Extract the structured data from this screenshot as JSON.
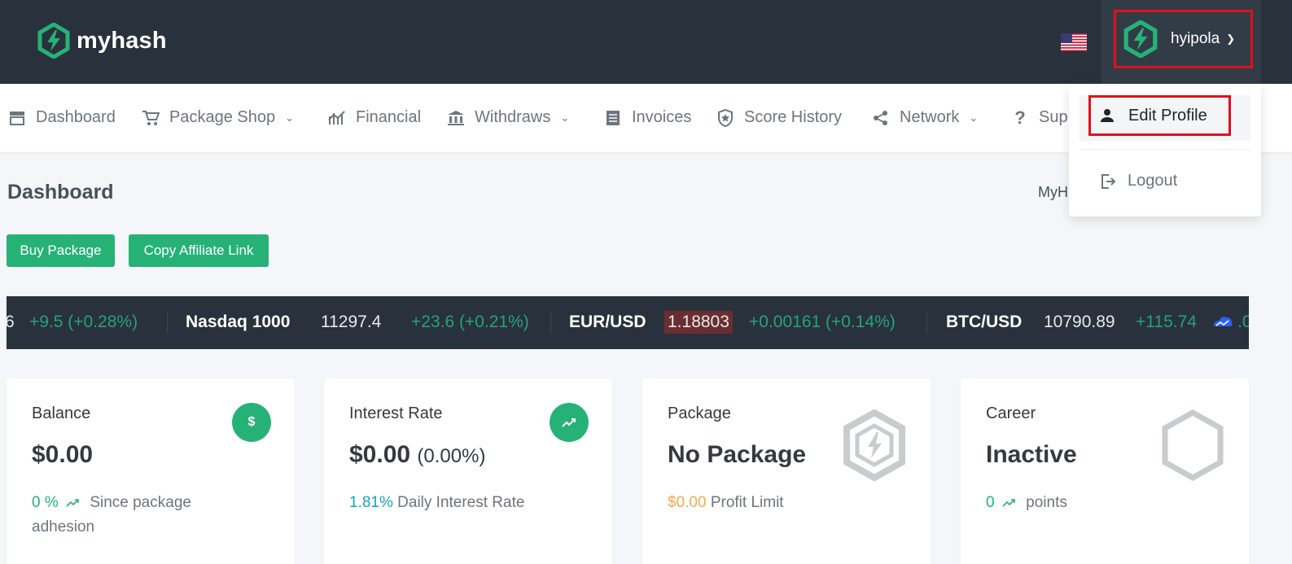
{
  "brand": {
    "name": "myhash",
    "color": "#26b277"
  },
  "header": {
    "username": "hyipola",
    "flag": "us-flag-icon"
  },
  "nav": {
    "items": [
      {
        "label": "Dashboard",
        "icon": "storefront-icon"
      },
      {
        "label": "Package Shop",
        "icon": "cart-icon",
        "has_dropdown": true
      },
      {
        "label": "Financial",
        "icon": "chart-icon"
      },
      {
        "label": "Withdraws",
        "icon": "bank-icon",
        "has_dropdown": true
      },
      {
        "label": "Invoices",
        "icon": "invoice-icon"
      },
      {
        "label": "Score History",
        "icon": "shield-star-icon"
      },
      {
        "label": "Network",
        "icon": "share-icon",
        "has_dropdown": true
      },
      {
        "label": "Sup",
        "icon": "question-icon"
      }
    ]
  },
  "page": {
    "title": "Dashboard",
    "breadcrumb_partial": "MyH",
    "buttons": {
      "buy": "Buy Package",
      "affiliate": "Copy Affiliate Link"
    }
  },
  "ticker": {
    "first_value": "6",
    "first_change": "+9.5 (+0.28%)",
    "items": [
      {
        "symbol": "Nasdaq 1000",
        "price": "11297.4",
        "change": "+23.6 (+0.21%)"
      },
      {
        "symbol": "EUR/USD",
        "price": "1.18803",
        "change": "+0.00161 (+0.14%)"
      },
      {
        "symbol": "BTC/USD",
        "price": "10790.89",
        "change": "+115.74",
        "trail": ".0"
      }
    ]
  },
  "cards": [
    {
      "label": "Balance",
      "value": "$0.00",
      "sub_value": "0 %",
      "sub_line1": "Since package",
      "sub_line2": "adhesion",
      "icon": "dollar-icon"
    },
    {
      "label": "Interest Rate",
      "value": "$0.00",
      "value_suffix": "(0.00%)",
      "sub_value": "1.81%",
      "sub_text": "Daily Interest Rate",
      "icon": "trending-up-icon"
    },
    {
      "label": "Package",
      "value": "No Package",
      "sub_value": "$0.00",
      "sub_text": "Profit Limit",
      "icon": "hexagon-logo-icon"
    },
    {
      "label": "Career",
      "value": "Inactive",
      "sub_value": "0",
      "sub_text": "points",
      "icon": "hexagon-icon"
    }
  ],
  "dropdown": {
    "edit_profile": "Edit Profile",
    "logout": "Logout"
  },
  "colors": {
    "topbar": "#29323c",
    "accent": "#26b277",
    "highlight_border": "#e0101a",
    "teal": "#17a2b8",
    "orange": "#f0ad4e"
  }
}
